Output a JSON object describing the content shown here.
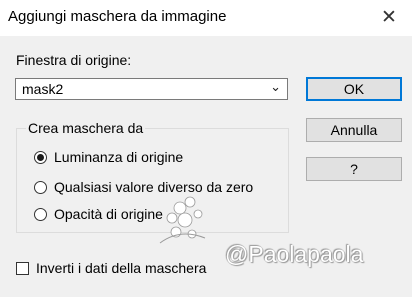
{
  "window": {
    "title": "Aggiungi maschera da immagine",
    "close_icon": "close-icon"
  },
  "source": {
    "label": "Finestra di origine:",
    "selected": "mask2",
    "dropdown_icon": "chevron-down-icon"
  },
  "buttons": {
    "ok": "OK",
    "cancel": "Annulla",
    "help": "?"
  },
  "create_group": {
    "title": "Crea maschera da",
    "options": [
      {
        "label": "Luminanza di origine",
        "selected": true
      },
      {
        "label": "Qualsiasi valore diverso da zero",
        "selected": false
      },
      {
        "label": "Opacità di origine",
        "selected": false
      }
    ]
  },
  "invert": {
    "label": "Inverti i dati della maschera",
    "checked": false
  },
  "watermark": {
    "text": "@Paolapaola",
    "icon": "flower-icon"
  }
}
